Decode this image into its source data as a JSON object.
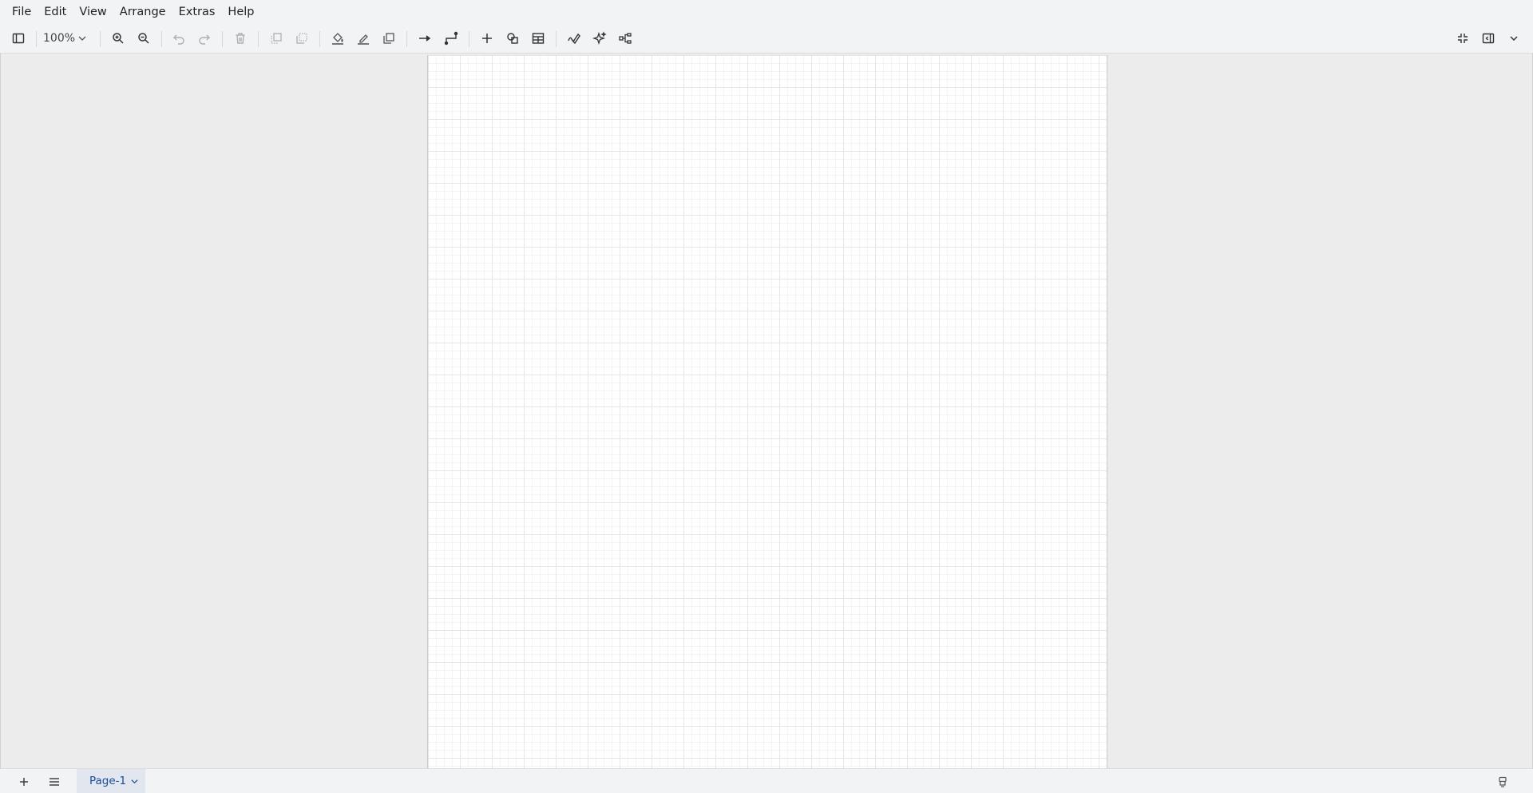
{
  "menubar": {
    "items": [
      {
        "label": "File"
      },
      {
        "label": "Edit"
      },
      {
        "label": "View"
      },
      {
        "label": "Arrange"
      },
      {
        "label": "Extras"
      },
      {
        "label": "Help"
      }
    ]
  },
  "toolbar": {
    "zoom_label": "100%",
    "icons": [
      "sidebar-toggle-icon",
      "zoom-in-icon",
      "zoom-out-icon",
      "undo-icon",
      "redo-icon",
      "delete-icon",
      "to-front-icon",
      "to-back-icon",
      "fill-color-icon",
      "line-color-icon",
      "shadow-icon",
      "connection-icon",
      "waypoints-icon",
      "insert-icon",
      "shapes-icon",
      "table-icon",
      "freehand-icon",
      "generate-icon",
      "format-layout-icon",
      "fullscreen-icon",
      "format-panel-icon",
      "collapse-icon"
    ]
  },
  "footer": {
    "page_tab_label": "Page-1"
  },
  "colors": {
    "chrome_bg": "#f1f3f4",
    "canvas_bg": "#ececec",
    "page_bg": "#ffffff",
    "page_tab_text": "#1a4b9c"
  }
}
